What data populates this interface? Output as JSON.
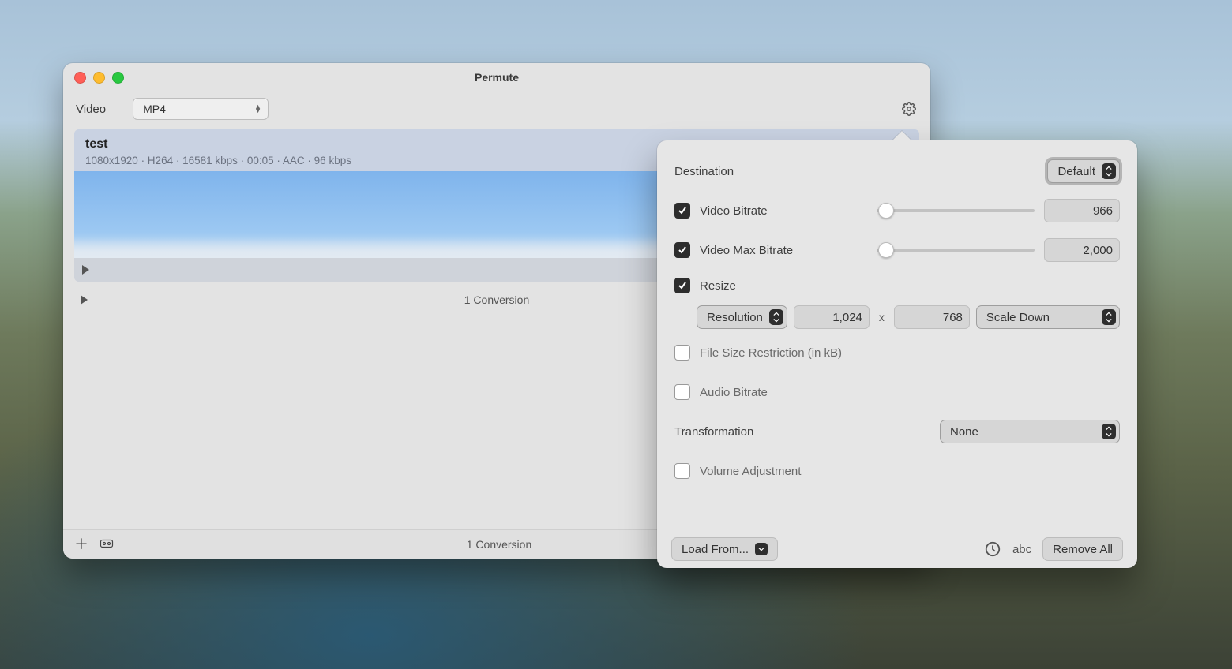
{
  "window": {
    "title": "Permute",
    "category_label": "Video",
    "format_selected": "MP4"
  },
  "item": {
    "title": "test",
    "subtitle": "1080x1920 · H264 · 16581 kbps · 00:05 · AAC · 96 kbps"
  },
  "list": {
    "summary": "1 Conversion"
  },
  "status_bar": {
    "summary": "1 Conversion"
  },
  "panel": {
    "destination_label": "Destination",
    "destination_value": "Default",
    "video_bitrate": {
      "label": "Video Bitrate",
      "checked": true,
      "value": "966",
      "slider_pct": 6
    },
    "video_max_bitrate": {
      "label": "Video Max Bitrate",
      "checked": true,
      "value": "2,000",
      "slider_pct": 6
    },
    "resize": {
      "label": "Resize",
      "checked": true,
      "mode": "Resolution",
      "width": "1,024",
      "height": "768",
      "scale": "Scale Down"
    },
    "filesize": {
      "label": "File Size Restriction (in kB)",
      "checked": false
    },
    "audio_bitrate": {
      "label": "Audio Bitrate",
      "checked": false
    },
    "transformation": {
      "label": "Transformation",
      "value": "None"
    },
    "volume": {
      "label": "Volume Adjustment",
      "checked": false
    },
    "load_from": "Load From...",
    "abc": "abc",
    "remove_all": "Remove All"
  }
}
